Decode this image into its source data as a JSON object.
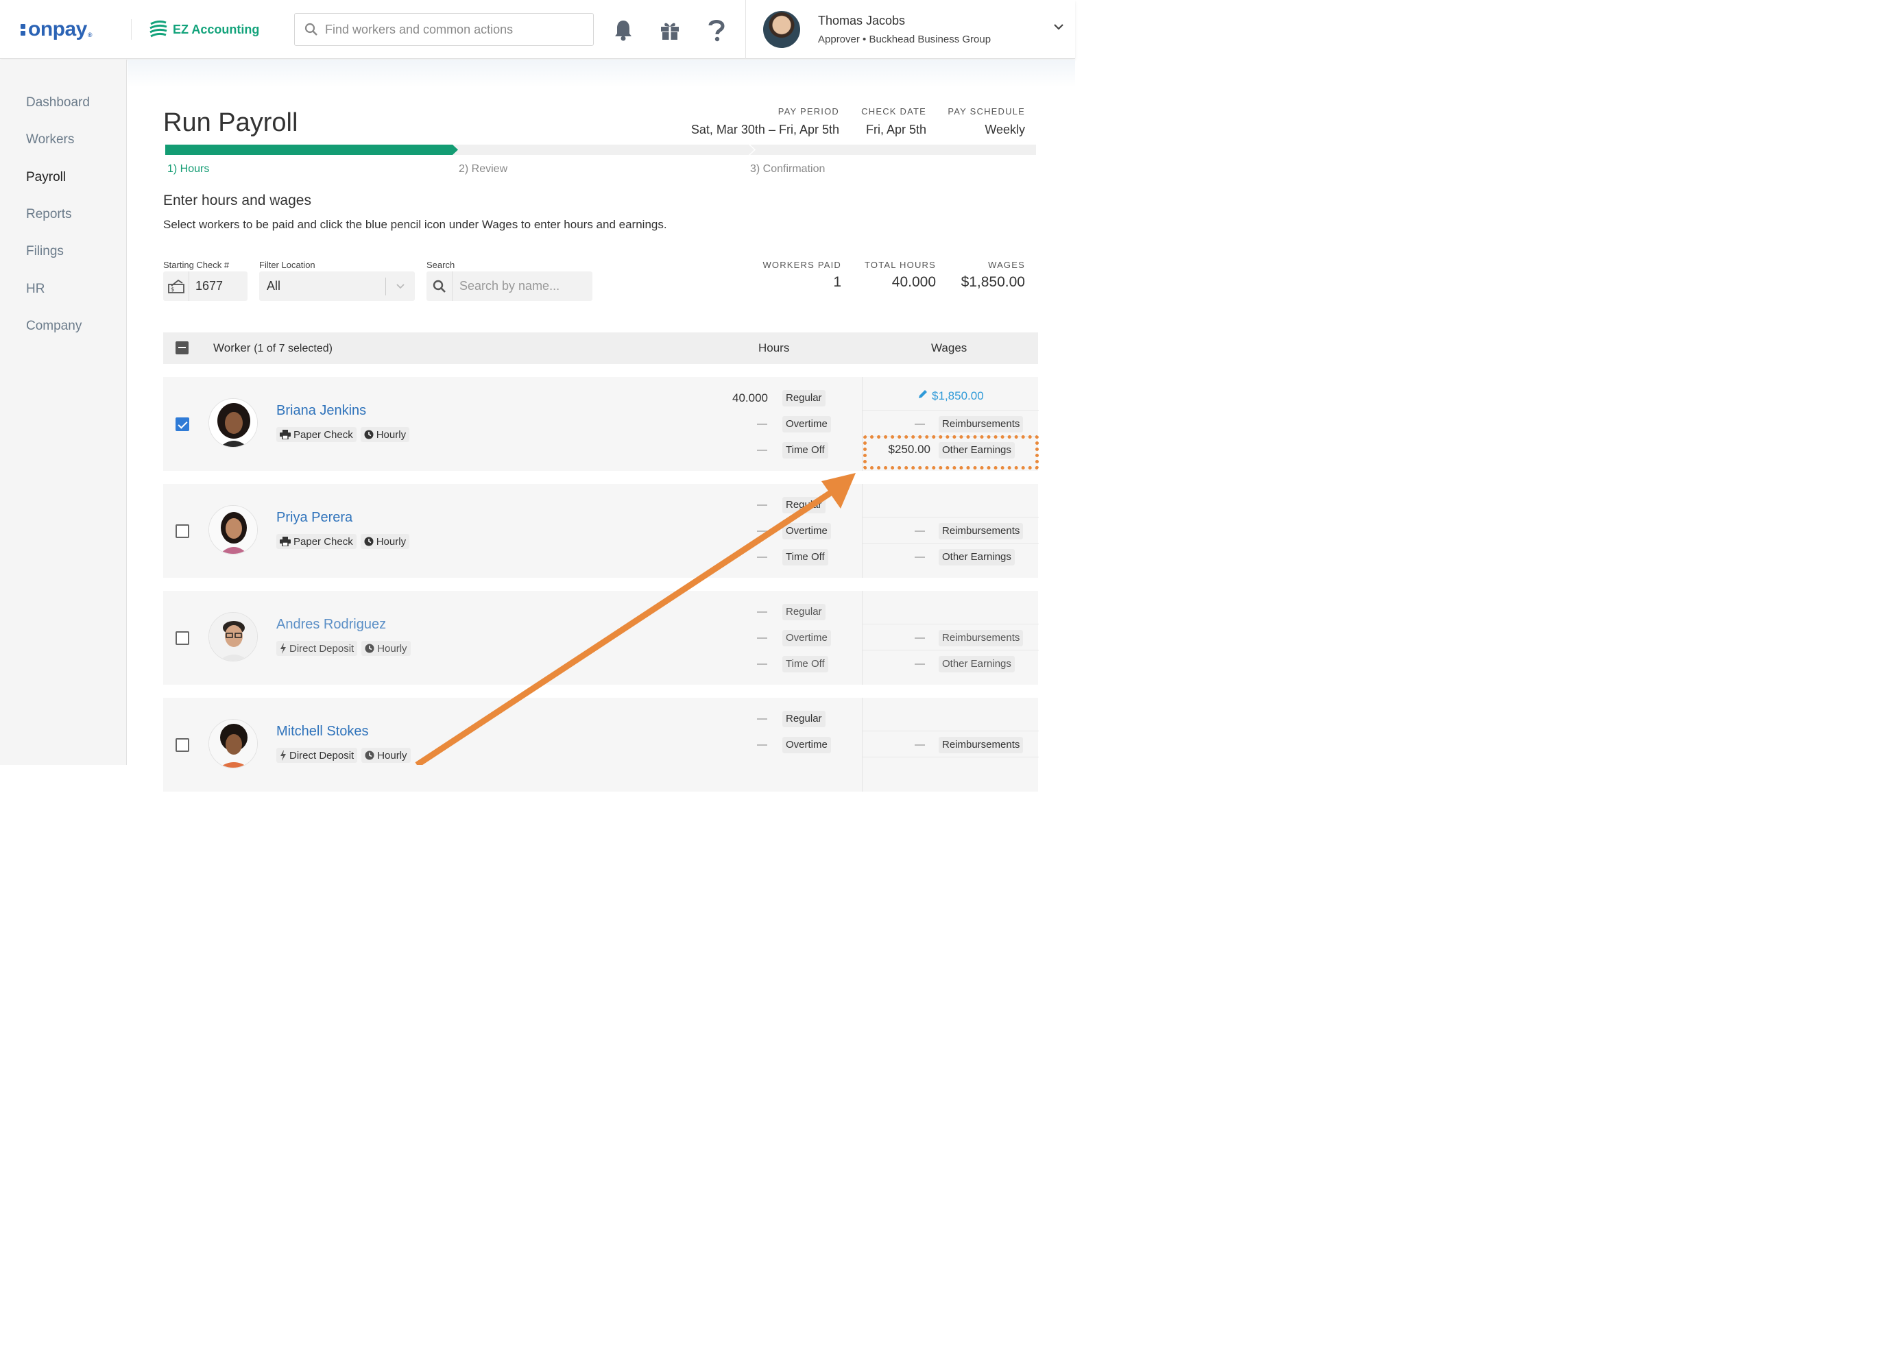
{
  "header": {
    "brand": "onpay",
    "partner": "EZ Accounting",
    "search_placeholder": "Find workers and common actions",
    "user": {
      "name": "Thomas Jacobs",
      "role": "Approver • Buckhead Business Group"
    }
  },
  "sidebar": {
    "items": [
      {
        "label": "Dashboard"
      },
      {
        "label": "Workers"
      },
      {
        "label": "Payroll",
        "active": true
      },
      {
        "label": "Reports"
      },
      {
        "label": "Filings"
      },
      {
        "label": "HR"
      },
      {
        "label": "Company"
      }
    ]
  },
  "page": {
    "title": "Run Payroll",
    "pay_period_label": "PAY PERIOD",
    "pay_period": "Sat, Mar 30th – Fri, Apr 5th",
    "check_date_label": "CHECK DATE",
    "check_date": "Fri, Apr 5th",
    "pay_schedule_label": "PAY SCHEDULE",
    "pay_schedule": "Weekly",
    "steps": [
      "1) Hours",
      "2) Review",
      "3) Confirmation"
    ],
    "section_title": "Enter hours and wages",
    "section_sub": "Select workers to be paid and click the blue pencil icon under Wages to enter hours and earnings."
  },
  "filters": {
    "starting_check_label": "Starting Check #",
    "starting_check": "1677",
    "location_label": "Filter Location",
    "location": "All",
    "search_label": "Search",
    "search_placeholder": "Search by name..."
  },
  "summary": {
    "workers_paid_label": "WORKERS PAID",
    "workers_paid": "1",
    "total_hours_label": "TOTAL HOURS",
    "total_hours": "40.000",
    "wages_label": "WAGES",
    "wages": "$1,850.00"
  },
  "table": {
    "worker_col": "Worker",
    "worker_count": "(1 of 7 selected)",
    "hours_col": "Hours",
    "wages_col": "Wages",
    "hour_labels": [
      "Regular",
      "Overtime",
      "Time Off"
    ],
    "wage_labels": [
      "Reimbursements",
      "Other Earnings"
    ],
    "rows": [
      {
        "name": "Briana Jenkins",
        "method": "Paper Check",
        "type": "Hourly",
        "checked": true,
        "regular": "40.000",
        "wage_total": "$1,850.00",
        "other_earnings": "$250.00"
      },
      {
        "name": "Priya Perera",
        "method": "Paper Check",
        "type": "Hourly",
        "checked": false
      },
      {
        "name": "Andres Rodriguez",
        "method": "Direct Deposit",
        "type": "Hourly",
        "checked": false
      },
      {
        "name": "Mitchell Stokes",
        "method": "Direct Deposit",
        "type": "Hourly",
        "checked": false
      }
    ]
  },
  "colors": {
    "brand": "#2b63b5",
    "green": "#139c73",
    "link": "#2f73bb",
    "annotation": "#e9893b"
  }
}
